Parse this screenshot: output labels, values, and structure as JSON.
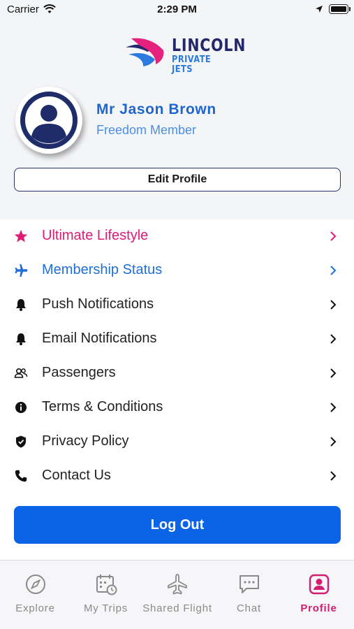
{
  "status_bar": {
    "carrier": "Carrier",
    "time": "2:29 PM"
  },
  "brand": {
    "line1": "LINCOLN",
    "line2": "PRIVATE JETS",
    "colors": {
      "navy": "#23286b",
      "blue": "#2a7ae0",
      "pink": "#e5207d"
    }
  },
  "profile": {
    "name": "Mr Jason Brown",
    "tier": "Freedom Member",
    "edit_label": "Edit Profile"
  },
  "menu": {
    "items": [
      {
        "label": "Ultimate Lifestyle",
        "icon": "star-icon",
        "color": "#e01a77"
      },
      {
        "label": "Membership Status",
        "icon": "plane-icon",
        "color": "#1f6fd6"
      },
      {
        "label": "Push Notifications",
        "icon": "bell-icon",
        "color": "#222222"
      },
      {
        "label": "Email Notifications",
        "icon": "bell-icon",
        "color": "#222222"
      },
      {
        "label": "Passengers",
        "icon": "people-icon",
        "color": "#222222"
      },
      {
        "label": "Terms & Conditions",
        "icon": "info-icon",
        "color": "#222222"
      },
      {
        "label": "Privacy Policy",
        "icon": "shield-icon",
        "color": "#222222"
      },
      {
        "label": "Contact Us",
        "icon": "phone-icon",
        "color": "#222222"
      }
    ]
  },
  "logout_label": "Log Out",
  "tabs": [
    {
      "label": "Explore",
      "icon": "compass-icon",
      "active": false
    },
    {
      "label": "My Trips",
      "icon": "calendar-icon",
      "active": false
    },
    {
      "label": "Shared Flight",
      "icon": "plane-icon",
      "active": false
    },
    {
      "label": "Chat",
      "icon": "chat-icon",
      "active": false
    },
    {
      "label": "Profile",
      "icon": "profile-icon",
      "active": true
    }
  ],
  "colors": {
    "accent": "#0b63e6",
    "active_tab": "#d21d72",
    "inactive_tab": "#8a8a8a"
  }
}
